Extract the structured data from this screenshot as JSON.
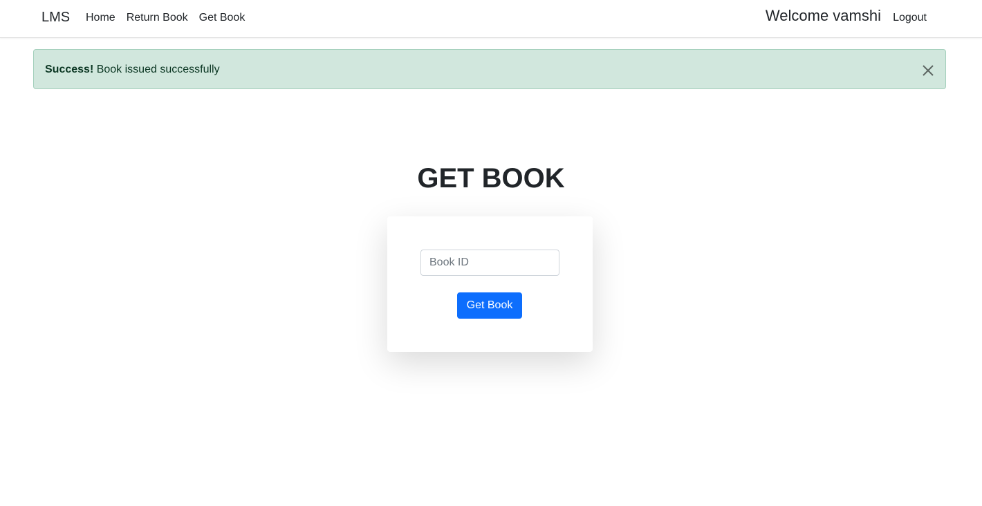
{
  "navbar": {
    "brand": "LMS",
    "links": [
      {
        "label": "Home"
      },
      {
        "label": "Return Book"
      },
      {
        "label": "Get Book"
      }
    ],
    "welcome": "Welcome vamshi",
    "logout": "Logout"
  },
  "alert": {
    "strong": "Success!",
    "message": " Book issued successfully",
    "close_icon": "close-icon",
    "background": "#d1e7dd",
    "text_color": "#0a3622"
  },
  "page": {
    "title": "GET BOOK"
  },
  "form": {
    "book_id_placeholder": "Book ID",
    "book_id_value": "",
    "submit_label": "Get Book",
    "accent": "#0d6efd"
  }
}
